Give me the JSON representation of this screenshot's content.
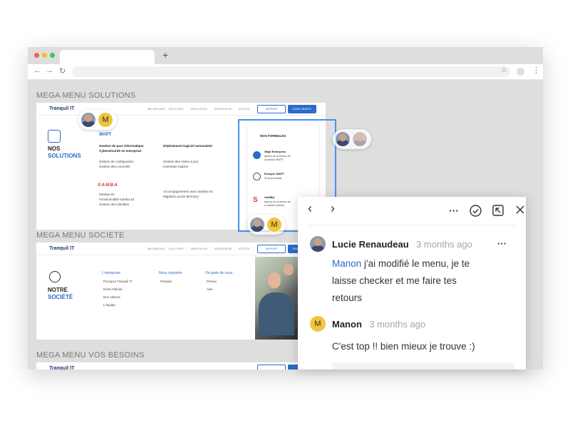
{
  "browser": {
    "new_tab_symbol": "+",
    "nav": {
      "back": "←",
      "forward": "→",
      "reload": "↻",
      "star": "☆",
      "menu": "⋮"
    }
  },
  "sections": {
    "solutions_label": "MEGA MENU SOLUTIONS",
    "societe_label": "MEGA MENU SOCIETE",
    "besoins_label": "MEGA MENU VOS BESOINS"
  },
  "mock": {
    "logo": "Tranquil IT",
    "nav_items": [
      "WIKI BESOINS",
      "SOLUTIONS",
      "TARIFICATION",
      "RESSOURCES",
      "SOCIETE"
    ],
    "support": "SUPPORT",
    "essai": "ESSAI GRATUIT",
    "solutions": {
      "title": "NOS",
      "title_blue": "SOLUTIONS",
      "wapt_logo": "WAPT",
      "col1": [
        "Gestion de parc informatique",
        "Cybersécurité en entreprise"
      ],
      "col1b": [
        "Gestion de configuration",
        "Gestion des correctifs"
      ],
      "col2_head": "Déploiement logiciel automatisé",
      "col2": [
        "Gestion des mises à jour",
        "Inventaire logiciel"
      ],
      "samba_logo": "SAMBA",
      "samba_items": [
        "Samba AD",
        "Fonctionnalité samba ad",
        "Gestion des identités"
      ],
      "samba_items2": [
        "Accompagnement avec Samba AD",
        "Migration active directory"
      ],
      "formules_title": "NOS FORMULES",
      "formules": [
        {
          "name": "Wapt Enterprise",
          "desc": "Aperçu de la version de",
          "desc2": "la solution WAPT"
        },
        {
          "name": "Essayer WAPT",
          "desc": "30 jours d'essai",
          "desc2": ""
        },
        {
          "name": "SAMBA",
          "desc": "Aperçu de la version de",
          "desc2": "la solution Samba"
        }
      ]
    },
    "societe": {
      "title": "NOTRE",
      "title_blue": "SOCIÉTÉ",
      "col1_head": "L'entreprise",
      "col1": [
        "Pourquoi Tranquil IT",
        "Notre histoire",
        "Nos valeurs",
        "L'équipe"
      ],
      "col2_head": "Nous rejoindre",
      "col2": [
        "Postuler"
      ],
      "col3_head": "On parle de nous",
      "col3": [
        "Presse",
        "Avis"
      ]
    }
  },
  "avatar_m": "M",
  "comments": {
    "toolbar": {
      "prev": "‹",
      "next": "›",
      "more": "···"
    },
    "items": [
      {
        "author": "Lucie Renaudeau",
        "time": "3 months ago",
        "mention": "Manon",
        "text_line1": " j'ai modifié le menu, je te",
        "text_line2": "laisse checker et me faire tes",
        "text_line3": "retours",
        "more": "···"
      },
      {
        "author": "Manon",
        "time": "3 months ago",
        "avatar": "M",
        "text": "C'est top !! bien mieux je trouve :)"
      }
    ]
  },
  "colors": {
    "accent": "#2b6bc9",
    "selection": "#4a8ff2",
    "avatar_m": "#f0c43c"
  }
}
